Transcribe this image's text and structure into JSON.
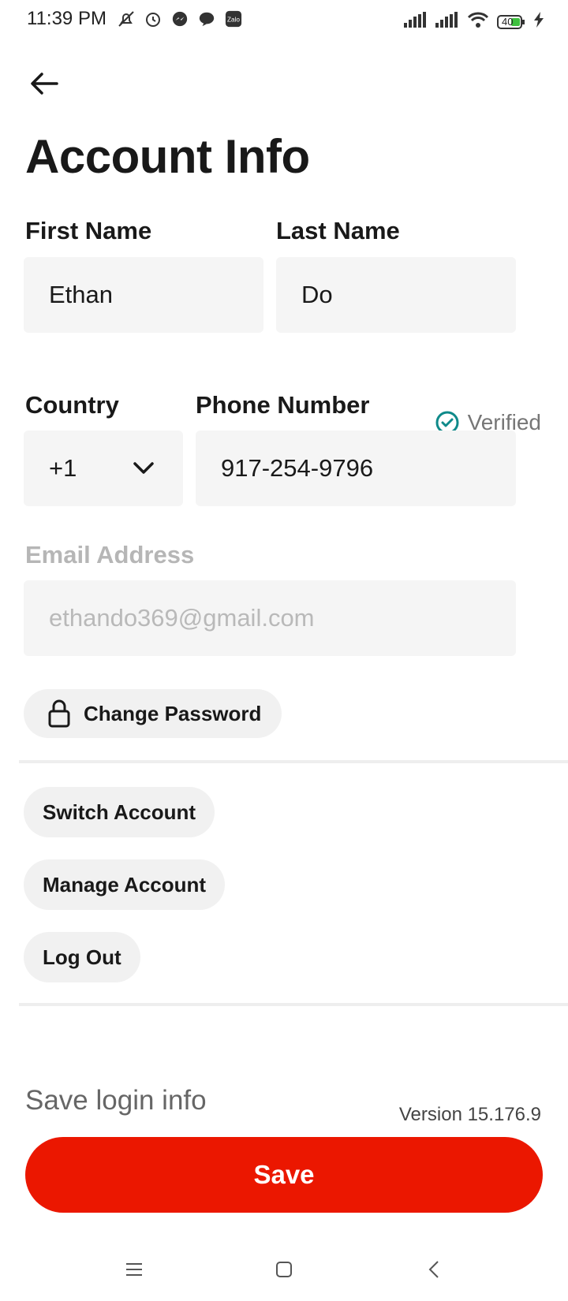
{
  "status_bar": {
    "time": "11:39 PM",
    "battery": "40",
    "left_icons": [
      "mute-icon",
      "alarm-icon",
      "messenger-icon",
      "chat-icon",
      "zalo-icon"
    ],
    "right_icons": [
      "signal-icon",
      "signal-icon",
      "wifi-icon",
      "battery-icon",
      "charging-icon"
    ]
  },
  "header": {
    "title": "Account Info"
  },
  "form": {
    "first_name": {
      "label": "First Name",
      "value": "Ethan"
    },
    "last_name": {
      "label": "Last Name",
      "value": "Do"
    },
    "country": {
      "label": "Country",
      "value": "+1"
    },
    "phone": {
      "label": "Phone Number",
      "value": "917-254-9796",
      "status": "Verified"
    },
    "email": {
      "label": "Email Address",
      "value": "ethando369@gmail.com"
    }
  },
  "actions": {
    "change_password": "Change Password",
    "switch_account": "Switch Account",
    "manage_account": "Manage Account",
    "log_out": "Log Out"
  },
  "footer": {
    "save_login": "Save login info",
    "version": "Version 15.176.9",
    "save": "Save"
  },
  "colors": {
    "accent": "#eb1700",
    "verified": "#0f8a8a",
    "field_bg": "#f5f5f5"
  }
}
